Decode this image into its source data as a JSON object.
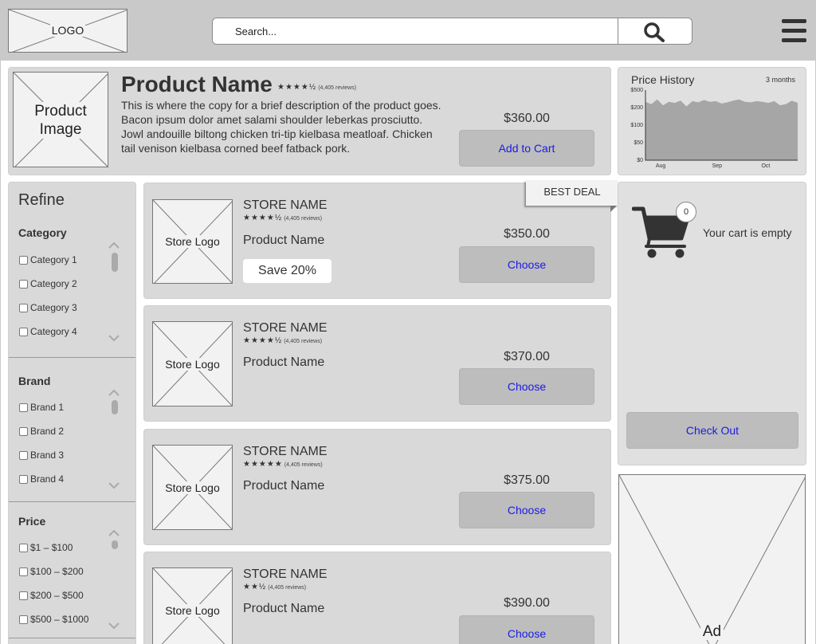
{
  "header": {
    "logo": "LOGO",
    "search_placeholder": "Search..."
  },
  "product": {
    "image_label": "Product Image",
    "name": "Product Name",
    "stars": "★★★★½",
    "reviews": "(4,405 reviews)",
    "description": "This is where the copy for a brief description of the product goes. Bacon ipsum dolor amet salami shoulder leberkas prosciutto. Jowl andouille biltong chicken tri-tip kielbasa meatloaf. Chicken tail venison kielbasa corned beef fatback pork.",
    "price": "$360.00",
    "cta": "Add to Cart"
  },
  "price_history": {
    "title": "Price History",
    "range": "3 months"
  },
  "chart_data": {
    "type": "area",
    "title": "Price History",
    "y_ticks": [
      "$0",
      "$50",
      "$100",
      "$200",
      "$500"
    ],
    "x_ticks": [
      "Aug",
      "Sep",
      "Oct"
    ],
    "values": [
      500,
      480,
      520,
      470,
      500,
      490,
      510,
      460,
      505,
      495,
      515,
      500,
      505,
      485,
      495,
      510,
      520,
      500,
      495,
      505,
      500,
      490,
      505,
      470,
      480,
      510,
      490
    ],
    "grid": false,
    "fill_color": "#a6a6a6"
  },
  "refine": {
    "title": "Refine",
    "groups": [
      {
        "title": "Category",
        "items": [
          "Category 1",
          "Category 2",
          "Category 3",
          "Category 4"
        ]
      },
      {
        "title": "Brand",
        "items": [
          "Brand 1",
          "Brand 2",
          "Brand 3",
          "Brand 4"
        ]
      },
      {
        "title": "Price",
        "items": [
          "$1 – $100",
          "$100 – $200",
          "$200 – $500",
          "$500 – $1000"
        ]
      }
    ]
  },
  "best_deal": "BEST DEAL",
  "deals": [
    {
      "logo": "Store Logo",
      "store": "STORE NAME",
      "stars": "★★★★½",
      "reviews": "(4,405 reviews)",
      "product": "Product Name",
      "save": "Save 20%",
      "price": "$350.00",
      "cta": "Choose"
    },
    {
      "logo": "Store Logo",
      "store": "STORE NAME",
      "stars": "★★★★½",
      "reviews": "(4,405 reviews)",
      "product": "Product Name",
      "price": "$370.00",
      "cta": "Choose"
    },
    {
      "logo": "Store Logo",
      "store": "STORE NAME",
      "stars": "★★★★★",
      "reviews": "(4,405 reviews)",
      "product": "Product Name",
      "price": "$375.00",
      "cta": "Choose"
    },
    {
      "logo": "Store Logo",
      "store": "STORE NAME",
      "stars": "★★½",
      "reviews": "(4,405 reviews)",
      "product": "Product Name",
      "price": "$390.00",
      "cta": "Choose"
    }
  ],
  "cart": {
    "count": "0",
    "empty_text": "Your cart is empty",
    "checkout": "Check Out"
  },
  "ad": {
    "label": "Ad"
  },
  "colors": {
    "link": "#1a1ae6",
    "panel": "#d9d9d9",
    "button": "#bdbdbd"
  }
}
